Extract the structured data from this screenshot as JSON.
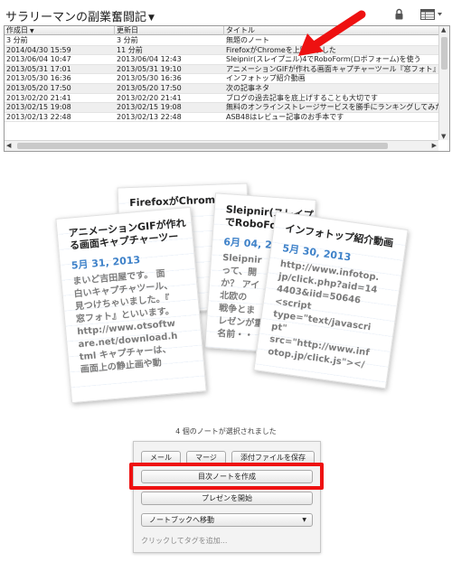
{
  "header": {
    "notebook_title": "サラリーマンの副業奮闘記",
    "lock_icon": "lock-icon",
    "view_icon": "list-view-icon"
  },
  "note_list": {
    "columns": [
      "作成日",
      "更新日",
      "タイトル"
    ],
    "sort_indicator": "▼",
    "rows": [
      {
        "created": "3 分前",
        "updated": "3 分前",
        "title": "無題のノート"
      },
      {
        "created": "2014/04/30 15:59",
        "updated": "11 分前",
        "title": "FirefoxがChromeを上回りました"
      },
      {
        "created": "2013/06/04 10:47",
        "updated": "2013/06/04 12:43",
        "title": "Sleipnir(スレイプニル)4でRoboForm(ロボフォーム)を使う"
      },
      {
        "created": "2013/05/31 17:01",
        "updated": "2013/05/31 19:10",
        "title": "アニメーションGIFが作れる画面キャプチャーツール『窓フォト』"
      },
      {
        "created": "2013/05/30 16:36",
        "updated": "2013/05/30 16:36",
        "title": "インフォトップ紹介動画"
      },
      {
        "created": "2013/05/20 17:50",
        "updated": "2013/05/20 17:50",
        "title": "次の記事ネタ"
      },
      {
        "created": "2013/02/20 21:41",
        "updated": "2013/02/20 21:41",
        "title": "ブログの過去記事を底上げすることも大切です"
      },
      {
        "created": "2013/02/15 19:08",
        "updated": "2013/02/15 19:08",
        "title": "無料のオンラインストレージサービスを勝手にランキングしてみた"
      },
      {
        "created": "2013/02/13 22:48",
        "updated": "2013/02/13 22:48",
        "title": "ASB48はレビュー記事のお手本です"
      }
    ]
  },
  "cards": {
    "firefox": {
      "title": "FirefoxがChromeを"
    },
    "sleipnir": {
      "title_1": "Sleipnir(スレイプニル)4",
      "title_2": "でRoboForm",
      "date": "6月 04, 2",
      "body": [
        "Sleipnir",
        "って、開",
        "か？ アイ",
        "北欧の",
        "戦争とま",
        "レゼンが重",
        "名前・・"
      ]
    },
    "animation_gif": {
      "title_1": "アニメーションGIFが作れ",
      "title_2": "る画面キャプチャーツー",
      "date": "5月 31, 2013",
      "body": [
        "まいど吉田屋です。 面",
        "白いキャプチャツール、",
        "見つけちゃいました。『",
        "窓フォト』といいます。",
        "http://www.otsoftw",
        "are.net/download.h",
        "tml キャプチャーは、",
        "画面上の静止画や動"
      ]
    },
    "infotop": {
      "title": "インフォトップ紹介動画",
      "date": "5月 30, 2013",
      "body": [
        "http://www.infotop.",
        "jp/click.php?aid=14",
        "4403&iid=50646",
        "<script",
        "type=\"text/javascri",
        "pt\"",
        "src=\"http://www.inf",
        "otop.jp/click.js\"></"
      ]
    }
  },
  "selection": {
    "caption": "4 個のノートが選択されました",
    "buttons": {
      "mail": "メール",
      "merge": "マージ",
      "attach": "添付ファイルを保存",
      "create_toc": "目次ノートを作成",
      "present": "プレゼンを開始",
      "move_to_notebook": "ノートブックへ移動"
    },
    "tag_placeholder": "クリックしてタグを追加..."
  },
  "colors": {
    "annotation_red": "#ee1111",
    "date_blue": "#3f82c9"
  }
}
